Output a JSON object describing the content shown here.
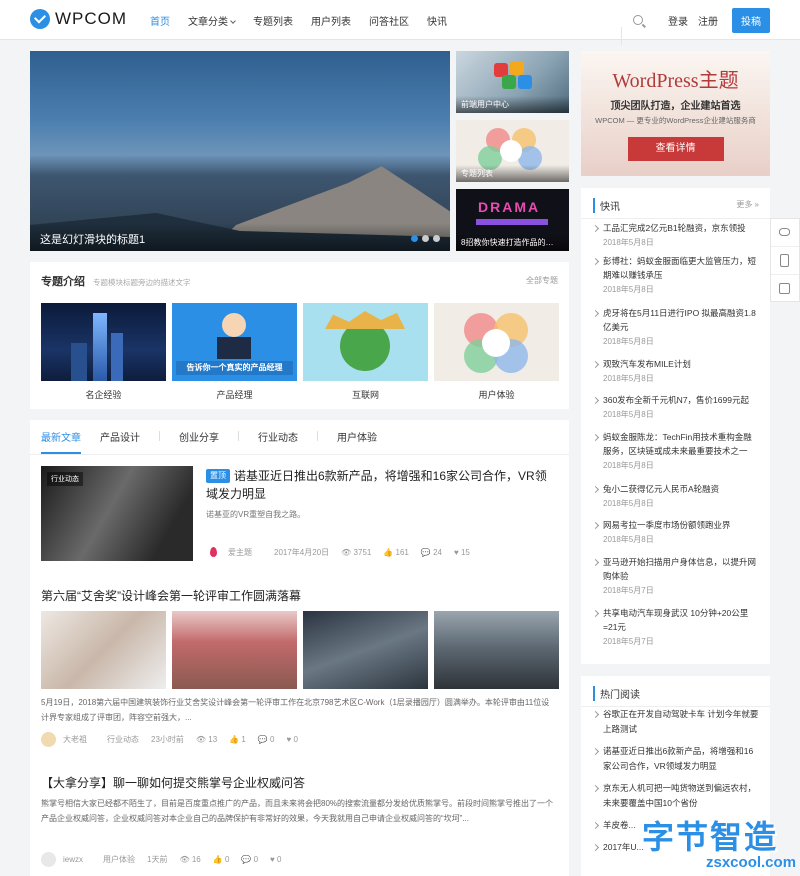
{
  "header": {
    "logo_text": "WPCOM",
    "nav": [
      "首页",
      "文章分类",
      "专题列表",
      "用户列表",
      "问答社区",
      "快讯"
    ],
    "login": "登录",
    "register": "注册",
    "post_button": "投稿",
    "accent_color": "#2b8fe6"
  },
  "slider": {
    "caption": "这是幻灯滑块的标题1",
    "slides": 3,
    "active_slide": 1
  },
  "featured": [
    "前端用户中心",
    "专题列表",
    "8招教你快速打造作品的…"
  ],
  "ad": {
    "title": "WordPress主题",
    "subtitle": "顶尖团队打造，企业建站首选",
    "note": "WPCOM — 更专业的WordPress企业建站服务商",
    "button": "查看详情"
  },
  "topics": {
    "heading": "专题介绍",
    "description": "专题模块标题旁边的描述文字",
    "more": "全部专题",
    "items": [
      "名企经验",
      "产品经理",
      "互联网",
      "用户体验"
    ],
    "banner_text": "告诉你一个真实的产品经理"
  },
  "tabs": [
    "最新文章",
    "产品设计",
    "创业分享",
    "行业动态",
    "用户体验"
  ],
  "posts": {
    "p1": {
      "image_tag": "行业动态",
      "badge": "置顶",
      "title": "诺基亚近日推出6款新产品，将增强和16家公司合作，VR领域发力明显",
      "excerpt": "诺基亚的VR重塑自我之路。",
      "author": "爱主题",
      "date": "2017年4月20日",
      "views": "3751",
      "likes": "161",
      "comments": "24",
      "favorites": "15"
    },
    "p2": {
      "title": "第六届“艾舍奖”设计峰会第一轮评审工作圆满落幕",
      "excerpt": "5月19日，2018第六届中国建筑装饰行业艾舍奖设计峰会第一轮评审工作在北京798艺术区C-Work（1层录播园厅）圆满举办。本轮评审由11位设计界专家组成了评审团，阵容空前强大，...",
      "author": "大老祖",
      "category": "行业动态",
      "time": "23小时前",
      "views": "13",
      "likes": "1",
      "comments": "0",
      "favorites": "0"
    },
    "p3": {
      "title": "【大拿分享】聊一聊如何提交熊掌号企业权威问答",
      "excerpt": "熊掌号相信大家已经都不陌生了，目前是百度重点推广的产品，而且未来将会把80%的搜索流量都分发给优质熊掌号。前段时间熊掌号推出了一个产品企业权威问答，企业权威问答对本企业自己的品牌保护有非常好的效果，今天我就用自己申请企业权威问答的“坎坷”...",
      "author": "iewzx",
      "category": "用户体验",
      "time": "1天前",
      "views": "16",
      "likes": "0",
      "comments": "0",
      "favorites": "0"
    }
  },
  "flash": {
    "heading": "快讯",
    "more": "更多 »",
    "items": [
      {
        "title": "工品汇完成2亿元B1轮融资，京东领投",
        "date": "2018年5月8日"
      },
      {
        "title": "彭博社：蚂蚁金服面临更大监管压力，短期难以赚钱承压",
        "date": "2018年5月8日"
      },
      {
        "title": "虎牙将在5月11日进行IPO 拟最高融资1.8亿美元",
        "date": "2018年5月8日"
      },
      {
        "title": "观致汽车发布MILE计划",
        "date": "2018年5月8日"
      },
      {
        "title": "360发布全新千元机N7，售价1699元起",
        "date": "2018年5月8日"
      },
      {
        "title": "蚂蚁金服陈龙：TechFin用技术重构金融服务，区块链或成未来最重要技术之一",
        "date": "2018年5月8日"
      },
      {
        "title": "兔小二获得亿元人民币A轮融资",
        "date": "2018年5月8日"
      },
      {
        "title": "网易考拉一季度市场份额领跑业界",
        "date": "2018年5月8日"
      },
      {
        "title": "亚马逊开始扫描用户身体信息，以提升网购体验",
        "date": "2018年5月7日"
      },
      {
        "title": "共享电动汽车现身武汉 10分钟+20公里=21元",
        "date": "2018年5月7日"
      }
    ]
  },
  "hot": {
    "heading": "热门阅读",
    "items": [
      "谷歌正在开发自动驾驶卡车 计划今年就要上路测试",
      "诺基亚近日推出6款新产品，将增强和16家公司合作，VR领域发力明显",
      "京东无人机可把一吨货物送到偏远农村，未来要覆盖中国10个省份",
      "羊皮卷...",
      "2017年U..."
    ]
  },
  "watermark": {
    "main": "字节智造",
    "sub": "zsxcool.com"
  }
}
